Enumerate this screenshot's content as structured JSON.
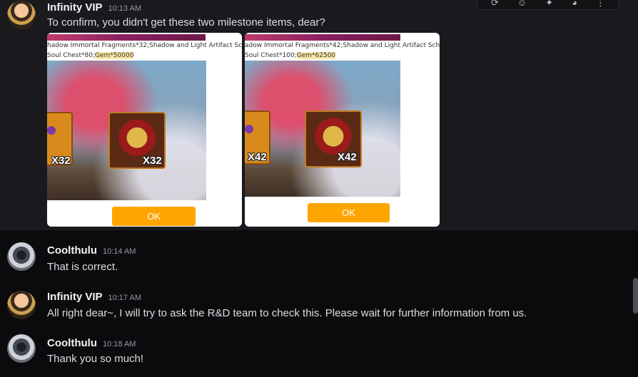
{
  "toolbar": {
    "icons": [
      "refresh-icon",
      "reaction-icon",
      "pin-icon",
      "reply-icon",
      "more-icon"
    ],
    "glyphs": [
      "⟳",
      "☺",
      "✦",
      "◕",
      "⋮"
    ]
  },
  "messages": [
    {
      "author": "Infinity VIP",
      "time": "10:13 AM",
      "text": "To confirm, you didn't get these two milestone items, dear?",
      "attachments": [
        {
          "line1": "hadow Immortal Fragments*32;Shadow and Light Artifact Schematic",
          "line2_prefix": "Soul Chest*80;",
          "line2_gem": "Gem*50000",
          "puzzle_qty": "X32",
          "chest_qty": "X32",
          "button": "OK"
        },
        {
          "line1": "adow Immortal Fragments*42;Shadow and Light Artifact Schematic F",
          "line2_prefix": "Soul Chest*100;",
          "line2_gem": "Gem*62500",
          "puzzle_qty": "X42",
          "chest_qty": "X42",
          "button": "OK"
        }
      ]
    },
    {
      "author": "Coolthulu",
      "time": "10:14 AM",
      "text": "That is correct."
    },
    {
      "author": "Infinity VIP",
      "time": "10:17 AM",
      "text": "All right dear~, I will try to ask the R&D team to check this. Please wait for further information from us."
    },
    {
      "author": "Coolthulu",
      "time": "10:18 AM",
      "text": "Thank you so much!"
    }
  ]
}
